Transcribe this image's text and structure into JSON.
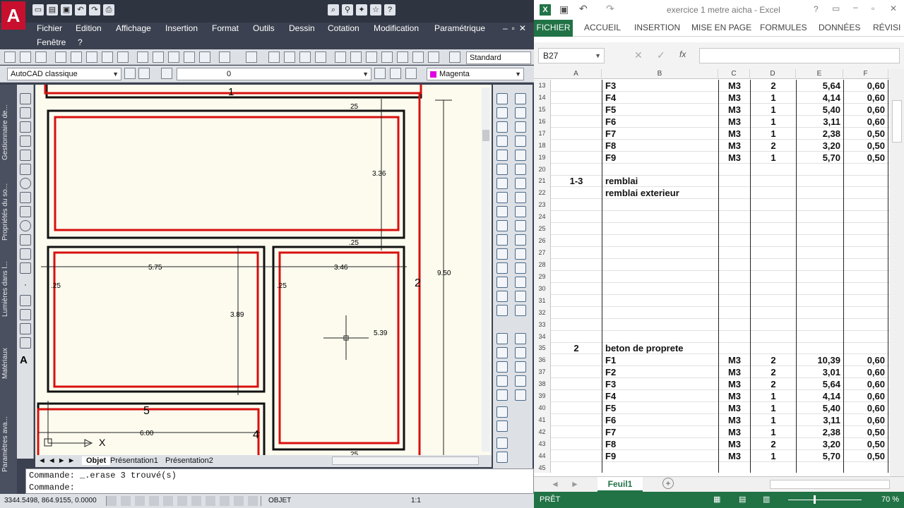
{
  "autocad": {
    "menu": [
      "Fichier",
      "Edition",
      "Affichage",
      "Insertion",
      "Format",
      "Outils",
      "Dessin",
      "Cotation",
      "Modification",
      "Paramétrique",
      "Fenêtre",
      "?"
    ],
    "text_style": "Standard",
    "workspace": "AutoCAD classique",
    "layer_value": "0",
    "color": "Magenta",
    "palette_tabs": [
      "Gestionnaire de...",
      "Propriétés du so...",
      "Lumières dans l...",
      "Matériaux",
      "Paramètres ava..."
    ],
    "drawing": {
      "room_numbers": [
        "1",
        "2",
        "5",
        "4"
      ],
      "dims": [
        "25",
        "3.36",
        ".25",
        "5.75",
        "3.46",
        "9.50",
        ".25",
        ".25",
        "3.89",
        "5.39",
        "6.00",
        "25"
      ],
      "x_axis_label": "X"
    },
    "layout_tabs": [
      "Objet",
      "Présentation1",
      "Présentation2"
    ],
    "command_lines": [
      "Commande:  _.erase 3 trouvé(s)",
      "Commande:"
    ],
    "coordinates": "3344.5498, 864.9155, 0.0000",
    "status_items": [
      "OBJET",
      "1:1"
    ]
  },
  "excel": {
    "title": "exercice 1 metre aicha - Excel",
    "tabs": [
      "FICHIER",
      "ACCUEIL",
      "INSERTION",
      "MISE EN PAGE",
      "FORMULES",
      "DONNÉES",
      "RÉVISI"
    ],
    "name_box": "B27",
    "fx": "fx",
    "columns": [
      "A",
      "B",
      "C",
      "D",
      "E",
      "F"
    ],
    "rows": [
      {
        "n": "13",
        "a": "",
        "b": "F3",
        "c": "M3",
        "d": "2",
        "e": "5,64",
        "f": "0,60"
      },
      {
        "n": "14",
        "a": "",
        "b": "F4",
        "c": "M3",
        "d": "1",
        "e": "4,14",
        "f": "0,60"
      },
      {
        "n": "15",
        "a": "",
        "b": "F5",
        "c": "M3",
        "d": "1",
        "e": "5,40",
        "f": "0,60"
      },
      {
        "n": "16",
        "a": "",
        "b": "F6",
        "c": "M3",
        "d": "1",
        "e": "3,11",
        "f": "0,60"
      },
      {
        "n": "17",
        "a": "",
        "b": "F7",
        "c": "M3",
        "d": "1",
        "e": "2,38",
        "f": "0,50"
      },
      {
        "n": "18",
        "a": "",
        "b": "F8",
        "c": "M3",
        "d": "2",
        "e": "3,20",
        "f": "0,50"
      },
      {
        "n": "19",
        "a": "",
        "b": "F9",
        "c": "M3",
        "d": "1",
        "e": "5,70",
        "f": "0,50"
      },
      {
        "n": "20",
        "a": "",
        "b": "",
        "c": "",
        "d": "",
        "e": "",
        "f": ""
      },
      {
        "n": "21",
        "a": "1-3",
        "b": "remblai",
        "c": "",
        "d": "",
        "e": "",
        "f": ""
      },
      {
        "n": "22",
        "a": "",
        "b": "remblai exterieur",
        "c": "",
        "d": "",
        "e": "",
        "f": ""
      },
      {
        "n": "23",
        "a": "",
        "b": "",
        "c": "",
        "d": "",
        "e": "",
        "f": ""
      },
      {
        "n": "24",
        "a": "",
        "b": "",
        "c": "",
        "d": "",
        "e": "",
        "f": ""
      },
      {
        "n": "25",
        "a": "",
        "b": "",
        "c": "",
        "d": "",
        "e": "",
        "f": ""
      },
      {
        "n": "26",
        "a": "",
        "b": "",
        "c": "",
        "d": "",
        "e": "",
        "f": ""
      },
      {
        "n": "27",
        "a": "",
        "b": "",
        "c": "",
        "d": "",
        "e": "",
        "f": ""
      },
      {
        "n": "28",
        "a": "",
        "b": "",
        "c": "",
        "d": "",
        "e": "",
        "f": ""
      },
      {
        "n": "29",
        "a": "",
        "b": "",
        "c": "",
        "d": "",
        "e": "",
        "f": ""
      },
      {
        "n": "30",
        "a": "",
        "b": "",
        "c": "",
        "d": "",
        "e": "",
        "f": ""
      },
      {
        "n": "31",
        "a": "",
        "b": "",
        "c": "",
        "d": "",
        "e": "",
        "f": ""
      },
      {
        "n": "32",
        "a": "",
        "b": "",
        "c": "",
        "d": "",
        "e": "",
        "f": ""
      },
      {
        "n": "33",
        "a": "",
        "b": "",
        "c": "",
        "d": "",
        "e": "",
        "f": ""
      },
      {
        "n": "34",
        "a": "",
        "b": "",
        "c": "",
        "d": "",
        "e": "",
        "f": ""
      },
      {
        "n": "35",
        "a": "2",
        "b": "beton de proprete",
        "c": "",
        "d": "",
        "e": "",
        "f": ""
      },
      {
        "n": "36",
        "a": "",
        "b": "F1",
        "c": "M3",
        "d": "2",
        "e": "10,39",
        "f": "0,60"
      },
      {
        "n": "37",
        "a": "",
        "b": "F2",
        "c": "M3",
        "d": "2",
        "e": "3,01",
        "f": "0,60"
      },
      {
        "n": "38",
        "a": "",
        "b": "F3",
        "c": "M3",
        "d": "2",
        "e": "5,64",
        "f": "0,60"
      },
      {
        "n": "39",
        "a": "",
        "b": "F4",
        "c": "M3",
        "d": "1",
        "e": "4,14",
        "f": "0,60"
      },
      {
        "n": "40",
        "a": "",
        "b": "F5",
        "c": "M3",
        "d": "1",
        "e": "5,40",
        "f": "0,60"
      },
      {
        "n": "41",
        "a": "",
        "b": "F6",
        "c": "M3",
        "d": "1",
        "e": "3,11",
        "f": "0,60"
      },
      {
        "n": "42",
        "a": "",
        "b": "F7",
        "c": "M3",
        "d": "1",
        "e": "2,38",
        "f": "0,50"
      },
      {
        "n": "43",
        "a": "",
        "b": "F8",
        "c": "M3",
        "d": "2",
        "e": "3,20",
        "f": "0,50"
      },
      {
        "n": "44",
        "a": "",
        "b": "F9",
        "c": "M3",
        "d": "1",
        "e": "5,70",
        "f": "0,50"
      },
      {
        "n": "45",
        "a": "",
        "b": "",
        "c": "",
        "d": "",
        "e": "",
        "f": ""
      }
    ],
    "sheet_tab": "Feuil1",
    "status_left": "PRÊT",
    "zoom": "70 %",
    "accent": "#217346"
  }
}
